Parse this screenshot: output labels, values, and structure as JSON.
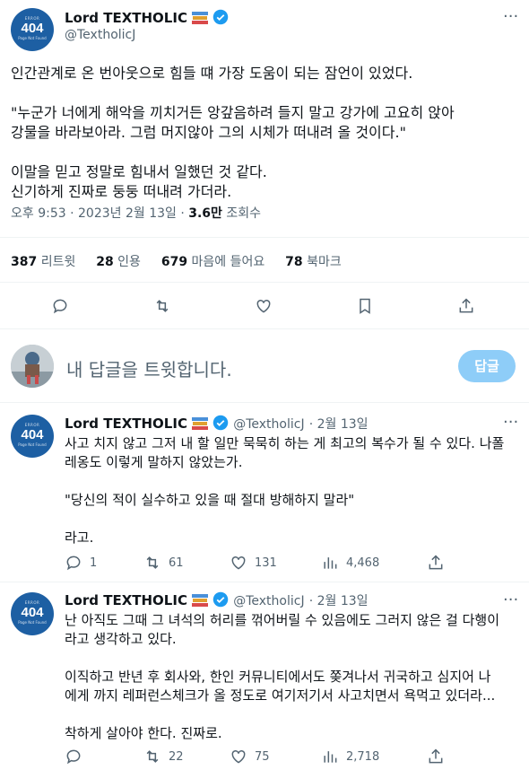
{
  "tweet": {
    "author_name": "Lord TEXTHOLIC",
    "handle": "@TextholicJ",
    "avatar_code": "404",
    "avatar_top": "ERROR",
    "avatar_sub": "Page Not Found",
    "text": "인간관계로 온 번아웃으로 힘들 떄 가장 도움이 되는 잠언이 있었다.\n\n\"누군가 너에게 해악을 끼치거든 앙갚음하려 들지 말고 강가에 고요히 앉아\n강물을 바라보아라. 그럼 머지않아 그의 시체가 떠내려 올 것이다.\"\n\n이말을 믿고 정말로 힘내서 일했던 것 같다.\n신기하게 진짜로 둥둥 떠내려 가더라.",
    "time": "오후 9:53 · 2023년 2월 13일 · ",
    "views": "3.6만",
    "views_label": " 조회수",
    "stats": {
      "retweets": "387",
      "retweets_label": "리트윗",
      "quotes": "28",
      "quotes_label": "인용",
      "likes": "679",
      "likes_label": "마음에 들어요",
      "bookmarks": "78",
      "bookmarks_label": "북마크"
    }
  },
  "compose": {
    "placeholder": "내 답글을 트윗합니다.",
    "button": "답글"
  },
  "replies": [
    {
      "author_name": "Lord TEXTHOLIC",
      "handle": "@TextholicJ",
      "date": "· 2월 13일",
      "text": "사고 치지 않고 그저 내 할 일만 묵묵히 하는 게 최고의 복수가 될 수 있다. 나폴\n레옹도 이렇게 말하지 않았는가.\n\n\"당신의 적이 실수하고 있을 때 절대 방해하지 말라\"\n\n라고.",
      "replies": "1",
      "retweets": "61",
      "likes": "131",
      "views": "4,468"
    },
    {
      "author_name": "Lord TEXTHOLIC",
      "handle": "@TextholicJ",
      "date": "· 2월 13일",
      "text": "난 아직도 그때 그 녀석의 허리를 꺾어버릴 수 있음에도 그러지 않은 걸 다행이\n라고 생각하고 있다.\n\n이직하고 반년 후 회사와, 한인 커뮤니티에서도 쫒겨나서 귀국하고 심지어 나\n에게 까지 레퍼런스체크가 올 정도로 여기저기서 사고치면서 욕먹고 있더라...\n\n착하게 살아야 한다. 진짜로.",
      "replies": "",
      "retweets": "22",
      "likes": "75",
      "views": "2,718"
    }
  ],
  "colors": {
    "accent": "#1d9bf0",
    "avatar_bg": "#1d5fa3",
    "button": "#8ecdf8"
  }
}
